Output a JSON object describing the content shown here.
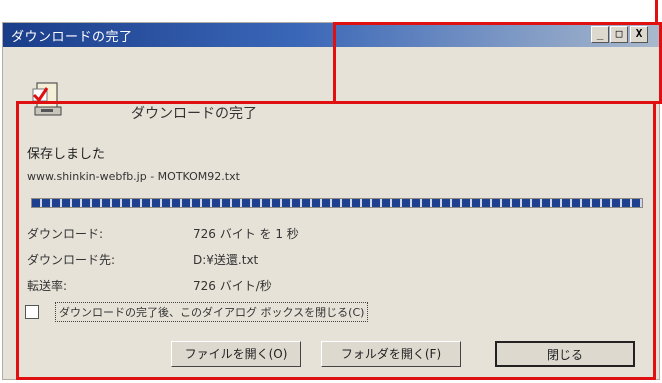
{
  "window": {
    "title": "ダウンロードの完了",
    "controls": {
      "minimize": "_",
      "maximize": "□",
      "close": "X"
    }
  },
  "content": {
    "heading": "ダウンロードの完了",
    "saved_text": "保存しました",
    "url_text": "www.shinkin-webfb.jp - MOTKOM92.txt",
    "progress_fraction": 1.0,
    "rows": [
      {
        "label": "ダウンロード:",
        "value": "726 バイト を 1 秒"
      },
      {
        "label": "ダウンロード先:",
        "value": "D:¥送還.txt"
      },
      {
        "label": "転送率:",
        "value": "726 バイト/秒"
      }
    ],
    "checkbox_label": "ダウンロードの完了後、このダイアログ ボックスを閉じる(C)",
    "checkbox_checked": false
  },
  "buttons": {
    "open_file": "ファイルを開く(O)",
    "open_folder": "フォルダを開く(F)",
    "close": "閉じる"
  },
  "colors": {
    "titlebar": "#1a3d8a",
    "annotation": "#e01010",
    "dialog_bg": "#e6e2d8"
  }
}
